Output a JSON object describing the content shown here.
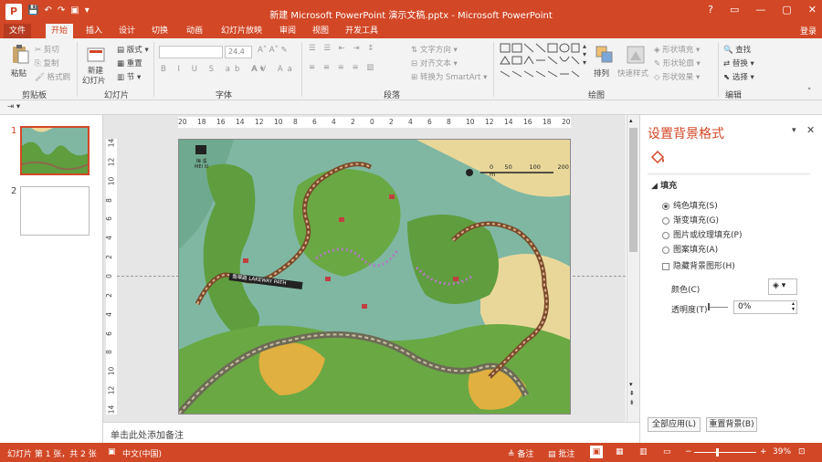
{
  "app": {
    "window_title": "新建 Microsoft PowerPoint 演示文稿.pptx - Microsoft PowerPoint",
    "app_icon_letter": "P",
    "login": "登录",
    "window_controls": [
      "?",
      "▭",
      "—",
      "▢",
      "✕"
    ],
    "qat": [
      "💾",
      "↶",
      "↷",
      "▣",
      "▾"
    ]
  },
  "tabs": [
    "文件",
    "开始",
    "插入",
    "设计",
    "切换",
    "动画",
    "幻灯片放映",
    "审阅",
    "视图",
    "开发工具"
  ],
  "ribbon": {
    "clipboard": {
      "paste": "粘贴",
      "cut": "剪切",
      "copy": "复制",
      "format_painter": "格式刷",
      "label": "剪贴板"
    },
    "slides": {
      "new_slide_l1": "新建",
      "new_slide_l2": "幻灯片",
      "layout": "版式",
      "reset": "重置",
      "section": "节",
      "label": "幻灯片"
    },
    "font": {
      "font_name": "",
      "font_size": "24.4",
      "label": "字体"
    },
    "paragraph": {
      "text_direction": "文字方向",
      "align_text": "对齐文本",
      "smartart": "转换为 SmartArt",
      "label": "段落"
    },
    "drawing": {
      "arrange": "排列",
      "quick_styles": "快速样式",
      "shape_fill": "形状填充",
      "shape_outline": "形状轮廓",
      "shape_effects": "形状效果",
      "label": "绘图"
    },
    "editing": {
      "find": "查找",
      "replace": "替换",
      "select": "选择",
      "label": "编辑"
    }
  },
  "ruler": {
    "h_ticks": [
      "20",
      "18",
      "16",
      "14",
      "12",
      "10",
      "8",
      "6",
      "4",
      "2",
      "0",
      "2",
      "4",
      "6",
      "8",
      "10",
      "12",
      "14",
      "16",
      "18",
      "20"
    ],
    "v_ticks": [
      "14",
      "12",
      "10",
      "8",
      "6",
      "4",
      "2",
      "0",
      "2",
      "4",
      "6",
      "8",
      "10",
      "12",
      "14"
    ]
  },
  "thumbnails": {
    "slide1": "1",
    "slide2": "2"
  },
  "slide": {
    "scale_labels": [
      "0",
      "50",
      "100",
      "200",
      "m"
    ],
    "logo_text": "梅 溪",
    "logo_sub": "MEI XI",
    "path_label_cn": "翡翠路",
    "path_label_en": "LAKEWAY PATH"
  },
  "notes_placeholder": "单击此处添加备注",
  "panel": {
    "title": "设置背景格式",
    "section": "填充",
    "options": [
      "纯色填充(S)",
      "渐变填充(G)",
      "图片或纹理填充(P)",
      "图案填充(A)"
    ],
    "selected_index": 0,
    "hide_bg": "隐藏背景图形(H)",
    "color_label": "颜色(C)",
    "transparency_label": "透明度(T)",
    "transparency_value": "0%",
    "apply_all": "全部应用(L)",
    "reset_bg": "重置背景(B)"
  },
  "status": {
    "slide_info": "幻灯片 第 1 张，共 2 张",
    "language": "中文(中国)",
    "notes": "备注",
    "comments": "批注",
    "zoom": "39%",
    "zoom_fraction": 0.39
  },
  "colors": {
    "accent": "#d24726",
    "ribbon_bg": "#f3f3f3",
    "map_water": "#7fb7a3",
    "map_green": "#5f9d3e",
    "map_sand": "#e9d79a"
  }
}
